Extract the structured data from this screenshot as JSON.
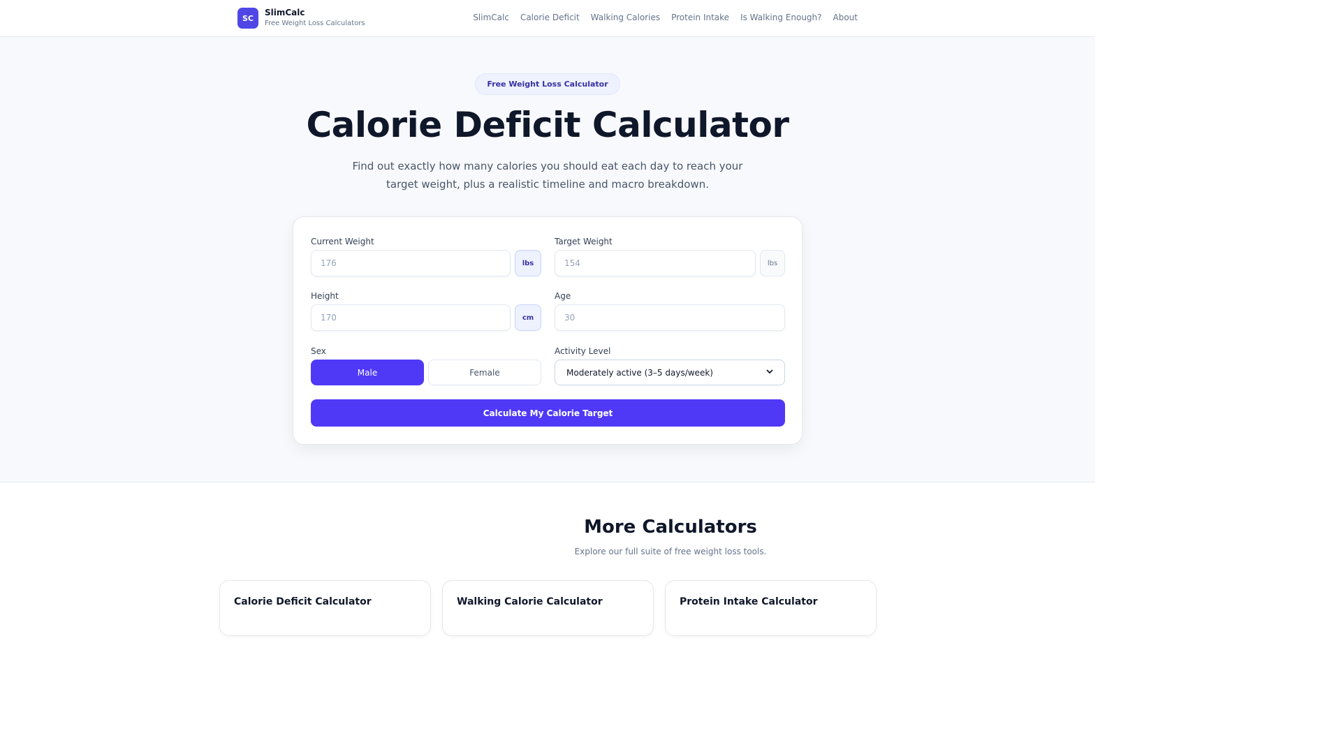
{
  "header": {
    "logo_text": "SC",
    "brand_name": "SlimCalc",
    "brand_tagline": "Free Weight Loss Calculators",
    "nav": [
      "SlimCalc",
      "Calorie Deficit",
      "Walking Calories",
      "Protein Intake",
      "Is Walking Enough?",
      "About"
    ]
  },
  "hero": {
    "badge": "Free Weight Loss Calculator",
    "title": "Calorie Deficit Calculator",
    "subtitle": "Find out exactly how many calories you should eat each day to reach your target weight, plus a realistic timeline and macro breakdown."
  },
  "form": {
    "current_weight": {
      "label": "Current Weight",
      "placeholder": "176",
      "unit": "lbs"
    },
    "target_weight": {
      "label": "Target Weight",
      "placeholder": "154",
      "unit": "lbs"
    },
    "height": {
      "label": "Height",
      "placeholder": "170",
      "unit": "cm"
    },
    "age": {
      "label": "Age",
      "placeholder": "30"
    },
    "sex": {
      "label": "Sex",
      "options": [
        "Male",
        "Female"
      ],
      "selected": "Male"
    },
    "activity": {
      "label": "Activity Level",
      "selected": "Moderately active (3–5 days/week)"
    },
    "submit_label": "Calculate My Calorie Target"
  },
  "more": {
    "title": "More Calculators",
    "subtitle": "Explore our full suite of free weight loss tools.",
    "cards": [
      "Calorie Deficit Calculator",
      "Walking Calorie Calculator",
      "Protein Intake Calculator"
    ]
  },
  "colors": {
    "accent": "#4f39f6",
    "logo": "#4f46e5",
    "badge_bg": "#eef2ff",
    "hero_bg": "#f8f9fc"
  }
}
